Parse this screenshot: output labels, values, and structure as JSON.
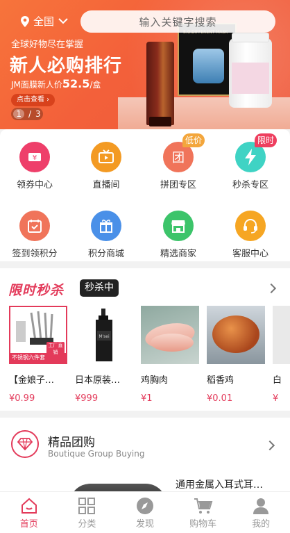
{
  "header": {
    "location": "全国",
    "search_placeholder": "输入关键字搜索"
  },
  "banner": {
    "slogan": "全球好物尽在掌握",
    "headline": "新人必购排行",
    "price_prefix": "JM面膜新人价",
    "price_value": "52.5",
    "price_suffix": "/盒",
    "button": "点击查看",
    "page_current": "1",
    "page_total": "3"
  },
  "menu": [
    {
      "label": "领券中心",
      "icon": "coupon-icon",
      "color": "#ee3f6a"
    },
    {
      "label": "直播间",
      "icon": "live-tv-icon",
      "color": "#f39a23"
    },
    {
      "label": "拼团专区",
      "icon": "group-buy-icon",
      "color": "#f0745a",
      "tag": "低价",
      "tag_color": "#f3a63c"
    },
    {
      "label": "秒杀专区",
      "icon": "flash-icon",
      "color": "#3fd3c4",
      "tag": "限时",
      "tag_color": "#ee3f5f"
    },
    {
      "label": "签到领积分",
      "icon": "checkin-icon",
      "color": "#f0745a"
    },
    {
      "label": "积分商城",
      "icon": "gift-icon",
      "color": "#4a90e8"
    },
    {
      "label": "精选商家",
      "icon": "shop-icon",
      "color": "#3cc46a"
    },
    {
      "label": "客服中心",
      "icon": "service-icon",
      "color": "#f6a623"
    }
  ],
  "flash_sale": {
    "title": "限时秒杀",
    "status": "秒杀中",
    "products": [
      {
        "name": "【金娘子…",
        "price": "¥0.99",
        "badge": "不锈钢六件套",
        "badge2": "工厂直销"
      },
      {
        "name": "日本原装…",
        "price": "¥999"
      },
      {
        "name": "鸡胸肉",
        "price": "¥1"
      },
      {
        "name": "稻香鸡",
        "price": "¥0.01"
      },
      {
        "name": "白",
        "price": "¥"
      }
    ]
  },
  "group_buy": {
    "title": "精品团购",
    "subtitle": "Boutique Group Buying",
    "first_product": "通用金属入耳式耳…"
  },
  "tabbar": [
    {
      "label": "首页",
      "icon": "home-icon",
      "active": true
    },
    {
      "label": "分类",
      "icon": "category-icon",
      "active": false
    },
    {
      "label": "发现",
      "icon": "discover-icon",
      "active": false
    },
    {
      "label": "购物车",
      "icon": "cart-icon",
      "active": false
    },
    {
      "label": "我的",
      "icon": "profile-icon",
      "active": false
    }
  ],
  "colors": {
    "accent": "#e33a5a",
    "banner": "#f3603a"
  }
}
